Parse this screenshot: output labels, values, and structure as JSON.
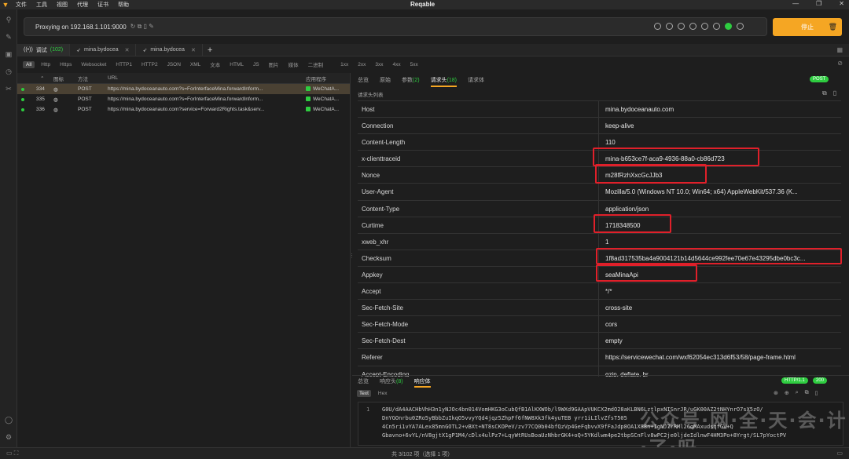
{
  "titlebar": {
    "menu": [
      "文件",
      "工具",
      "视图",
      "代理",
      "证书",
      "帮助"
    ],
    "title": "Reqable",
    "controls": [
      "—",
      "❐",
      "✕"
    ]
  },
  "proxy": {
    "label": "Proxying on 192.168.1.101:9000",
    "stop_label": "停止"
  },
  "tabs": [
    {
      "label": "调试",
      "count": "(102)"
    },
    {
      "label": "mina.bydocea"
    },
    {
      "label": "mina.bydocea"
    }
  ],
  "filters": [
    "All",
    "Http",
    "Https",
    "Websocket",
    "HTTP1",
    "HTTP2",
    "JSON",
    "XML",
    "文本",
    "HTML",
    "JS",
    "图片",
    "媒体",
    "二进制",
    "1xx",
    "2xx",
    "3xx",
    "4xx",
    "5xx"
  ],
  "list": {
    "headers": {
      "icon": "图标",
      "method": "方法",
      "url": "URL",
      "app": "应用程序"
    },
    "rows": [
      {
        "id": "334",
        "method": "POST",
        "url": "https://mina.bydoceanauto.com?s=ForInterfaceMina.forwardInform...",
        "app": "WeChatA..."
      },
      {
        "id": "335",
        "method": "POST",
        "url": "https://mina.bydoceanauto.com?s=ForInterfaceMina.forwardInform...",
        "app": "WeChatA..."
      },
      {
        "id": "336",
        "method": "POST",
        "url": "https://mina.bydoceanauto.com?service=Forward2Rights.task&serv...",
        "app": "WeChatA..."
      }
    ]
  },
  "detail": {
    "tabs": [
      "总览",
      "原始",
      "参数",
      "请求头",
      "请求体"
    ],
    "params_count": "(2)",
    "headers_count": "(18)",
    "method_badge": "POST",
    "sublabel": "请求头列表",
    "headers": [
      {
        "k": "Host",
        "v": "mina.bydoceanauto.com"
      },
      {
        "k": "Connection",
        "v": "keep-alive"
      },
      {
        "k": "Content-Length",
        "v": "110"
      },
      {
        "k": "x-clienttraceid",
        "v": "mina-b653ce7f-aca9-4936-88a0-cb86d723"
      },
      {
        "k": "Nonce",
        "v": "m28fRzhXxcGcJJb3"
      },
      {
        "k": "User-Agent",
        "v": "Mozilla/5.0 (Windows NT 10.0; Win64; x64) AppleWebKit/537.36 (K..."
      },
      {
        "k": "Content-Type",
        "v": "application/json"
      },
      {
        "k": "Curtime",
        "v": "1718348500"
      },
      {
        "k": "xweb_xhr",
        "v": "1"
      },
      {
        "k": "Checksum",
        "v": "1f8ad317535ba4a9004121b14d5644ce992fee70e67e43295dbe0bc3c..."
      },
      {
        "k": "Appkey",
        "v": "seaMinaApi"
      },
      {
        "k": "Accept",
        "v": "*/*"
      },
      {
        "k": "Sec-Fetch-Site",
        "v": "cross-site"
      },
      {
        "k": "Sec-Fetch-Mode",
        "v": "cors"
      },
      {
        "k": "Sec-Fetch-Dest",
        "v": "empty"
      },
      {
        "k": "Referer",
        "v": "https://servicewechat.com/wxf62054ec313d6f53/58/page-frame.html"
      },
      {
        "k": "Accept-Encoding",
        "v": "gzip, deflate, br"
      }
    ]
  },
  "response": {
    "tabs": [
      "总览",
      "响应头",
      "响应体"
    ],
    "headers_count": "(8)",
    "http_badge": "HTTP/1.1",
    "status_badge": "200",
    "formats": [
      "Text",
      "Hex"
    ],
    "line_no": "1",
    "body_lines": [
      "G0U/dA4AACHbVhH3n1yNJOc4bn014VomHKG3oCubQfB1AlKXWOb/l9WXd9GAApVUKCX2mdO28aKLBN6LztlpxNISnrJR/uGK00AZ2tNHYnrO7sX5zO/",
      "DnYGOnrbu0ZRo5yBbbZuIkqO5vvyYQd4jqz5ZhpFf6fNW8Xk3fk4yuTEB yrr1iLIlvZfsT505",
      "4Cn5ri1vYA7ALex85mnGOTL2+vBXt+NT8sCKOPeV/zv77CQ0b04bfQzVp4GeFqbvvX9fFaJdp8OA1X88n+IgNJ7YRMl26qMAxudsqfGV+Q",
      "Gbavno+6vYL/nV8gjtX1gP1M4/cDlx4ulPz7+LqyWtRUsBoaUzNhbrGK4+oQ+5YKdlwm4pe2tbpSCnFlv8wPC2je0ljdeIdlnwF4HM3Po+8Yrgt/SL7pYoctPV"
    ],
    "watermark": "公众号·网·全·天·会·计·了·吗"
  },
  "status": {
    "count": "共 3/102 项（选择 1 项）"
  }
}
